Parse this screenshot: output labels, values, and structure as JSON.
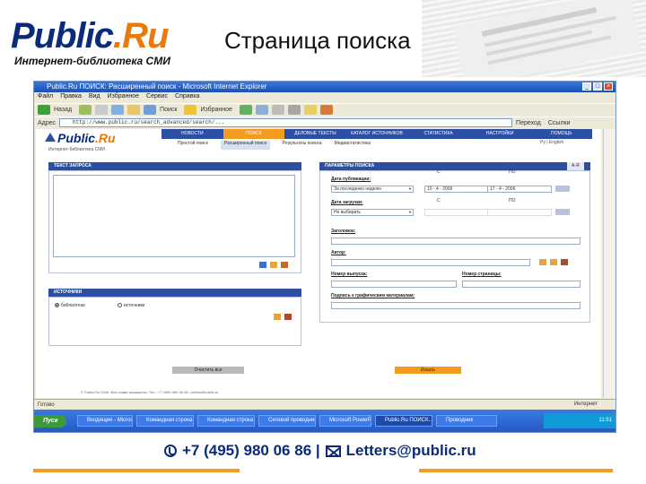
{
  "header": {
    "logo_part1": "Public",
    "logo_part2": ".Ru",
    "logo_subtitle": "Интернет-библиотека СМИ",
    "title": "Страница поиска"
  },
  "browser": {
    "window_title": "Public.Ru ПОИСК: Расширенный поиск - Microsoft Internet Explorer",
    "menu": [
      "Файл",
      "Правка",
      "Вид",
      "Избранное",
      "Сервис",
      "Справка"
    ],
    "toolbar": [
      "Назад",
      "Поиск",
      "Избранное"
    ],
    "address_label": "Адрес",
    "address_value": "http://www.public.ru/search_advanced/search/...",
    "go_label": "Переход",
    "links_label": "Ссылки",
    "status_text": "Готово",
    "status_zone": "Интернет"
  },
  "site": {
    "logo_part1": "Public",
    "logo_part2": ".Ru",
    "logo_subtitle": "Интернет-библиотека СМИ",
    "nav": [
      "НОВОСТИ",
      "ПОИСК",
      "ДЕЛОВЫЕ ТЕКСТЫ",
      "КАТАЛОГ ИСТОЧНИКОВ",
      "СТАТИСТИКА",
      "НАСТРОЙКИ",
      "ПОМОЩЬ"
    ],
    "nav_active_index": 1,
    "subnav": [
      "Простой поиск",
      "Расширенный поиск",
      "Результаты поиска",
      "Медиастатистика"
    ],
    "subnav_active_index": 1,
    "lang": "Ру | English",
    "query_panel_title": "ТЕКСТ ЗАПРОСА",
    "sources_panel_title": "ИСТОЧНИКИ",
    "params_panel_title": "ПАРАМЕТРЫ ПОИСКА",
    "az_button": "А-Я",
    "source_radio_1": "библиотеки",
    "source_radio_2": "источники",
    "pub_date_label": "Дата публикации:",
    "pub_date_select": "За последнюю неделю",
    "from_label": "С",
    "to_label": "ПО",
    "pub_date_from": "10 - 4 - 2006",
    "pub_date_to": "17 - 4 - 2006",
    "load_date_label": "Дата загрузки:",
    "load_date_select": "Не выбирать",
    "title_label": "Заголовок:",
    "author_label": "Автор:",
    "issue_label": "Номер выпуска:",
    "page_label": "Номер страницы:",
    "caption_label": "Подпись к графическим материалам:",
    "clear_button": "Очистить все",
    "search_button": "Искать",
    "footer_text": "© Public.Ru 2006. Все права защищены. Тел.: +7 (495) 980 06 86, Letters@public.ru"
  },
  "taskbar": {
    "start": "Пуск",
    "items": [
      "Входящие - Microsoft...",
      "Командная строка",
      "Командная строка",
      "Сетевой проводник",
      "Microsoft PowerPoint",
      "Public.Ru ПОИСК...",
      "Проводник"
    ],
    "active_index": 5,
    "clock": "11:51"
  },
  "footer": {
    "phone": "+7 (495) 980 06 86 |",
    "email": "Letters@public.ru"
  },
  "colors": {
    "brand_blue": "#0a2a7a",
    "brand_orange": "#e87b0c",
    "site_nav": "#2b4fa3",
    "accent_orange": "#f39b1e"
  }
}
